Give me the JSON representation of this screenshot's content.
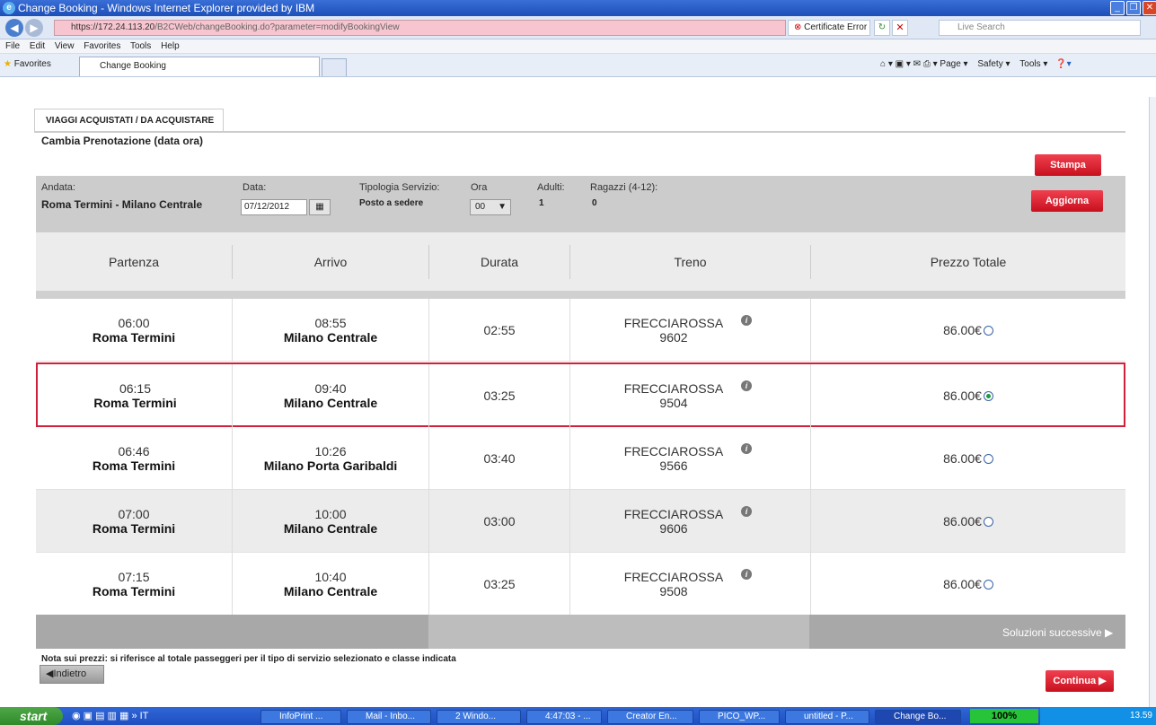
{
  "window": {
    "title": "Change Booking - Windows Internet Explorer provided by IBM"
  },
  "address": {
    "url_host": "https://172.24.113.20",
    "url_path": "/B2CWeb/changeBooking.do?parameter=modifyBookingView",
    "cert_error": "Certificate Error",
    "search_placeholder": "Live Search"
  },
  "menu": [
    "File",
    "Edit",
    "View",
    "Favorites",
    "Tools",
    "Help"
  ],
  "favorites": {
    "label": "Favorites",
    "tab_title": "Change Booking"
  },
  "commandbar": {
    "page": "Page ▾",
    "safety": "Safety ▾",
    "tools": "Tools ▾"
  },
  "page": {
    "tab_label": "VIAGGI ACQUISTATI / DA ACQUISTARE",
    "subtitle": "Cambia Prenotazione (data ora)",
    "print_button": "Stampa",
    "update_button": "Aggiorna",
    "form": {
      "andata_label": "Andata:",
      "andata_value": "Roma Termini - Milano Centrale",
      "data_label": "Data:",
      "data_value": "07/12/2012",
      "tipologia_label": "Tipologia Servizio:",
      "tipologia_value": "Posto a sedere",
      "ora_label": "Ora",
      "ora_value": "00",
      "adulti_label": "Adulti:",
      "adulti_value": "1",
      "ragazzi_label": "Ragazzi (4-12):",
      "ragazzi_value": "0"
    },
    "table": {
      "headers": [
        "Partenza",
        "Arrivo",
        "Durata",
        "Treno",
        "Prezzo Totale"
      ],
      "rows": [
        {
          "dep_time": "06:00",
          "dep_station": "Roma Termini",
          "arr_time": "08:55",
          "arr_station": "Milano Centrale",
          "duration": "02:55",
          "train_name": "FRECCIAROSSA",
          "train_no": "9602",
          "price": "86.00€",
          "selected": false
        },
        {
          "dep_time": "06:15",
          "dep_station": "Roma Termini",
          "arr_time": "09:40",
          "arr_station": "Milano Centrale",
          "duration": "03:25",
          "train_name": "FRECCIAROSSA",
          "train_no": "9504",
          "price": "86.00€",
          "selected": true
        },
        {
          "dep_time": "06:46",
          "dep_station": "Roma Termini",
          "arr_time": "10:26",
          "arr_station": "Milano Porta Garibaldi",
          "duration": "03:40",
          "train_name": "FRECCIAROSSA",
          "train_no": "9566",
          "price": "86.00€",
          "selected": false
        },
        {
          "dep_time": "07:00",
          "dep_station": "Roma Termini",
          "arr_time": "10:00",
          "arr_station": "Milano Centrale",
          "duration": "03:00",
          "train_name": "FRECCIAROSSA",
          "train_no": "9606",
          "price": "86.00€",
          "selected": false
        },
        {
          "dep_time": "07:15",
          "dep_station": "Roma Termini",
          "arr_time": "10:40",
          "arr_station": "Milano Centrale",
          "duration": "03:25",
          "train_name": "FRECCIAROSSA",
          "train_no": "9508",
          "price": "86.00€",
          "selected": false
        }
      ],
      "next_solutions": "Soluzioni successive ▶"
    },
    "note": "Nota sui prezzi: si riferisce al totale passeggeri per il tipo di servizio selezionato e classe indicata",
    "back_button": "◀Indietro",
    "continue_button": "Continua ▶"
  },
  "taskbar": {
    "start": "start",
    "buttons": [
      "InfoPrint ...",
      "Mail - Inbo...",
      "2 Windo...",
      "4:47:03 - ...",
      "Creator En...",
      "PICO_WP...",
      "untitled - P...",
      "Change Bo..."
    ],
    "zoom": "100%",
    "clock": "13.59"
  },
  "colors": {
    "accent_red": "#d0203a",
    "ie_blue": "#1d4fb8"
  }
}
